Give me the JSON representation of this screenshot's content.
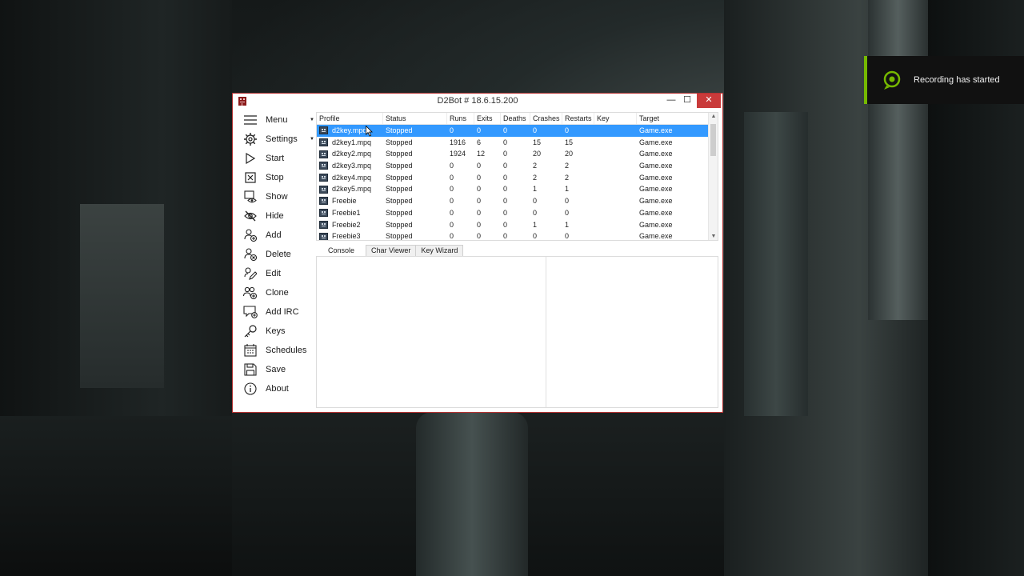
{
  "window": {
    "title": "D2Bot #  18.6.15.200",
    "minimize_glyph": "—",
    "maximize_glyph": "☐",
    "close_glyph": "✕"
  },
  "sidebar": {
    "items": [
      {
        "label": "Menu",
        "icon": "menu-icon"
      },
      {
        "label": "Settings",
        "icon": "gear-icon"
      },
      {
        "label": "Start",
        "icon": "play-icon"
      },
      {
        "label": "Stop",
        "icon": "stop-icon"
      },
      {
        "label": "Show",
        "icon": "eye-icon"
      },
      {
        "label": "Hide",
        "icon": "eye-off-icon"
      },
      {
        "label": "Add",
        "icon": "user-add-icon"
      },
      {
        "label": "Delete",
        "icon": "user-delete-icon"
      },
      {
        "label": "Edit",
        "icon": "pen-icon"
      },
      {
        "label": "Clone",
        "icon": "users-clone-icon"
      },
      {
        "label": "Add IRC",
        "icon": "chat-add-icon"
      },
      {
        "label": "Keys",
        "icon": "key-icon"
      },
      {
        "label": "Schedules",
        "icon": "calendar-icon"
      },
      {
        "label": "Save",
        "icon": "save-icon"
      },
      {
        "label": "About",
        "icon": "info-icon"
      }
    ]
  },
  "table": {
    "columns": [
      "Profile",
      "Status",
      "Runs",
      "Exits",
      "Deaths",
      "Crashes",
      "Restarts",
      "Key",
      "Target"
    ],
    "rows": [
      {
        "profile": "d2key.mpq",
        "status": "Stopped",
        "runs": "0",
        "exits": "0",
        "deaths": "0",
        "crashes": "0",
        "restarts": "0",
        "key": "",
        "target": "Game.exe"
      },
      {
        "profile": "d2key1.mpq",
        "status": "Stopped",
        "runs": "1916",
        "exits": "6",
        "deaths": "0",
        "crashes": "15",
        "restarts": "15",
        "key": "",
        "target": "Game.exe"
      },
      {
        "profile": "d2key2.mpq",
        "status": "Stopped",
        "runs": "1924",
        "exits": "12",
        "deaths": "0",
        "crashes": "20",
        "restarts": "20",
        "key": "",
        "target": "Game.exe"
      },
      {
        "profile": "d2key3.mpq",
        "status": "Stopped",
        "runs": "0",
        "exits": "0",
        "deaths": "0",
        "crashes": "2",
        "restarts": "2",
        "key": "",
        "target": "Game.exe"
      },
      {
        "profile": "d2key4.mpq",
        "status": "Stopped",
        "runs": "0",
        "exits": "0",
        "deaths": "0",
        "crashes": "2",
        "restarts": "2",
        "key": "",
        "target": "Game.exe"
      },
      {
        "profile": "d2key5.mpq",
        "status": "Stopped",
        "runs": "0",
        "exits": "0",
        "deaths": "0",
        "crashes": "1",
        "restarts": "1",
        "key": "",
        "target": "Game.exe"
      },
      {
        "profile": "Freebie",
        "status": "Stopped",
        "runs": "0",
        "exits": "0",
        "deaths": "0",
        "crashes": "0",
        "restarts": "0",
        "key": "",
        "target": "Game.exe"
      },
      {
        "profile": "Freebie1",
        "status": "Stopped",
        "runs": "0",
        "exits": "0",
        "deaths": "0",
        "crashes": "0",
        "restarts": "0",
        "key": "",
        "target": "Game.exe"
      },
      {
        "profile": "Freebie2",
        "status": "Stopped",
        "runs": "0",
        "exits": "0",
        "deaths": "0",
        "crashes": "1",
        "restarts": "1",
        "key": "",
        "target": "Game.exe"
      },
      {
        "profile": "Freebie3",
        "status": "Stopped",
        "runs": "0",
        "exits": "0",
        "deaths": "0",
        "crashes": "0",
        "restarts": "0",
        "key": "",
        "target": "Game.exe"
      }
    ]
  },
  "tabs": [
    {
      "label": "Console"
    },
    {
      "label": "Char Viewer"
    },
    {
      "label": "Key Wizard"
    }
  ],
  "notification": {
    "text": "Recording has started",
    "icon": "recording-icon",
    "accent": "#76b900"
  },
  "colors": {
    "selection": "#3399ff",
    "close_button": "#c93a3a"
  }
}
